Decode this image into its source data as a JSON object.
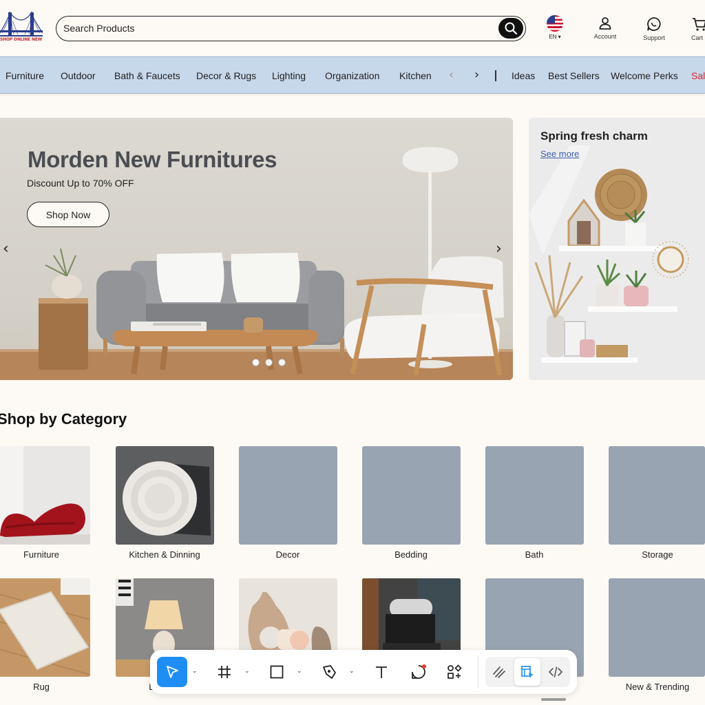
{
  "header": {
    "logo_text": "SHOP ONLINE NEW YORK",
    "search": {
      "placeholder": "Search Products"
    },
    "language": {
      "code": "EN"
    },
    "account_label": "Account",
    "support_label": "Support",
    "cart_label": "Cart"
  },
  "nav": {
    "items": [
      "Furniture",
      "Outdoor",
      "Bath & Faucets",
      "Decor & Rugs",
      "Lighting",
      "Organization",
      "Kitchen"
    ],
    "extra": [
      "Ideas",
      "Best Sellers",
      "Welcome Perks"
    ],
    "sale_label": "Sale",
    "sale_color": "#e0232a"
  },
  "hero": {
    "title": "Morden New Furnitures",
    "subtitle": "Discount Up to 70% OFF",
    "button_label": "Shop Now",
    "slides": 3,
    "active_slide": 1
  },
  "side_card": {
    "title": "Spring fresh charm",
    "link_label": "See more"
  },
  "categories": {
    "title": "Shop by Category",
    "row1": [
      "Furniture",
      "Kitchen & Dinning",
      "Decor",
      "Bedding",
      "Bath",
      "Storage"
    ],
    "row2": [
      "Rug",
      "Lighting",
      "",
      "",
      "",
      "New & Trending"
    ]
  },
  "colors": {
    "nav_bg": "#c8d8eb",
    "placeholder_tile": "#99a4b2",
    "toolbar_accent": "#1e8ef5",
    "link_blue": "#3b5fb0"
  },
  "toolbar": {
    "tools": [
      "cursor-icon",
      "frame-icon",
      "rectangle-icon",
      "pen-icon",
      "text-icon",
      "comment-icon",
      "components-icon"
    ],
    "modes": [
      "draw-icon",
      "design-icon",
      "code-icon"
    ],
    "active_tool": "cursor-icon",
    "active_mode": "design-icon"
  }
}
